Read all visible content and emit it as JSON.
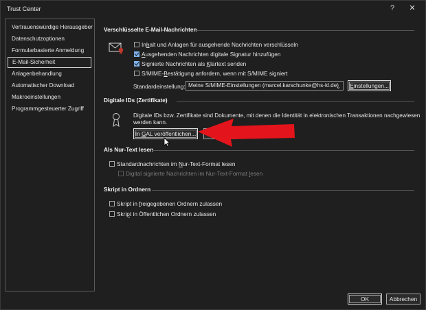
{
  "window": {
    "title": "Trust Center",
    "help_glyph": "?",
    "close_glyph": "✕"
  },
  "sidebar": {
    "items": [
      {
        "label": "Vertrauenswürdige Herausgeber"
      },
      {
        "label": "Datenschutzoptionen"
      },
      {
        "label": "Formularbasierte Anmeldung"
      },
      {
        "label": "E-Mail-Sicherheit",
        "selected": true
      },
      {
        "label": "Anlagenbehandlung"
      },
      {
        "label": "Automatischer Download"
      },
      {
        "label": "Makroeinstellungen"
      },
      {
        "label": "Programmgesteuerter Zugriff"
      }
    ]
  },
  "encrypted": {
    "heading": "Verschlüsselte E-Mail-Nachrichten",
    "options": [
      {
        "pre": "In",
        "u": "h",
        "post": "alt und Anlagen für ausgehende Nachrichten verschlüsseln",
        "checked": false
      },
      {
        "pre": "",
        "u": "A",
        "post": "usgehenden Nachrichten digitale Signatur hinzufügen",
        "checked": true
      },
      {
        "pre": "Signierte Nachrichten als ",
        "u": "K",
        "post": "lartext senden",
        "checked": true
      },
      {
        "pre": "S/MIME-",
        "u": "B",
        "post": "estätigung anfordern, wenn mit S/MIME signiert",
        "checked": false
      }
    ],
    "default_label": "Standardeinstellung:",
    "default_value": "Meine S/MIME-Einstellungen (marcel.karschunke@hs-kl.de)",
    "settings_pre": "",
    "settings_u": "E",
    "settings_post": "instellungen..."
  },
  "digital_ids": {
    "heading": "Digitale IDs (Zertifikate)",
    "description_line1": "Digitale IDs bzw. Zertifikate sind Dokumente, mit denen die Identität in elektronischen Transaktionen nachgewiesen",
    "description_line2": "werden kann.",
    "publish_pre": "In ",
    "publish_u": "G",
    "publish_post": "AL veröffentlichen..."
  },
  "plain_text": {
    "heading": "Als Nur-Text lesen",
    "option1_pre": "Standardnachrichten im ",
    "option1_u": "N",
    "option1_post": "ur-Text-Format lesen",
    "option1_checked": false,
    "option2_pre": "Digital signierte Nachrichten im Nur-Text-Format ",
    "option2_u": "l",
    "option2_post": "esen",
    "option2_checked": false
  },
  "folder_script": {
    "heading": "Skript in Ordnern",
    "option1_pre": "Skript in ",
    "option1_u": "f",
    "option1_post": "reigegebenen Ordnern zulassen",
    "option1_checked": false,
    "option2_pre": "Skri",
    "option2_u": "p",
    "option2_post": "t in Öffentlichen Ordnern zulassen",
    "option2_checked": false
  },
  "footer": {
    "ok": "OK",
    "cancel": "Abbrechen"
  },
  "colors": {
    "accent_checkbox": "#7fb2ea",
    "arrow": "#e3141b",
    "background": "#1f1f1f"
  }
}
